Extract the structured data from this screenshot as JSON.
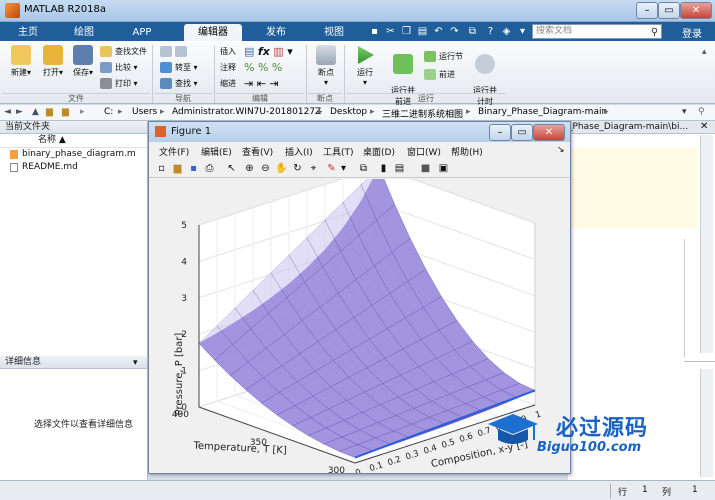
{
  "app": {
    "title": "MATLAB R2018a"
  },
  "ribbon_tabs": [
    "主页",
    "绘图",
    "APP",
    "编辑器",
    "发布",
    "视图"
  ],
  "search": {
    "placeholder": "搜索文档"
  },
  "login": "登录",
  "ribbon": {
    "file": {
      "new": "新建",
      "open": "打开",
      "save": "保存",
      "find_files": "查找文件",
      "compare": "比较",
      "print": "打印",
      "label": "文件"
    },
    "nav": {
      "goto": "转至",
      "find": "查找",
      "label": "导航"
    },
    "edit": {
      "insert": "插入",
      "comment": "注释",
      "indent": "缩进",
      "label": "编辑"
    },
    "breakpoint": {
      "breakpoint": "断点",
      "label": "断点"
    },
    "run": {
      "run": "运行",
      "run_advance": "运行并\n前进",
      "run_section": "运行节",
      "advance": "前进",
      "run_time": "运行并\n计时",
      "label": "运行"
    }
  },
  "path": [
    "C:",
    "Users",
    "Administrator.WIN7U-20180127Z",
    "Desktop",
    "三维二进制系统相图",
    "Binary_Phase_Diagram-main"
  ],
  "path_right": "_Phase_Diagram-main\\bi...",
  "current_folder": {
    "title": "当前文件夹",
    "column": "名称 ▲",
    "files": [
      "binary_phase_diagram.m",
      "README.md"
    ]
  },
  "details": {
    "title": "详细信息",
    "hint": "选择文件以查看详细信息"
  },
  "figure": {
    "title": "Figure 1",
    "menu": [
      "文件(F)",
      "编辑(E)",
      "查看(V)",
      "插入(I)",
      "工具(T)",
      "桌面(D)",
      "窗口(W)",
      "帮助(H)"
    ]
  },
  "chart_data": {
    "type": "surface3d",
    "zlabel": "Pressure, P [bar]",
    "ylabel": "Temperature, T [K]",
    "xlabel": "Composition, x-y [-]",
    "z_ticks": [
      0,
      1,
      2,
      3,
      4,
      5
    ],
    "zlim": [
      0,
      5
    ],
    "t_ticks": [
      300,
      350,
      400
    ],
    "tlim": [
      300,
      400
    ],
    "x_ticks": [
      0,
      0.1,
      0.2,
      0.3,
      0.4,
      0.5,
      0.6,
      0.7,
      0.8,
      0.9,
      1
    ],
    "xlim": [
      0,
      1
    ],
    "surface_color": "#5b3fc4",
    "surface_light": "#cbc2ee",
    "edge_color": "#3b2a9c"
  },
  "status": {
    "row": "行",
    "row_val": "1",
    "col": "列",
    "col_val": "1"
  },
  "watermark": {
    "cn": "必过源码",
    "en": "Biguo100.com"
  }
}
